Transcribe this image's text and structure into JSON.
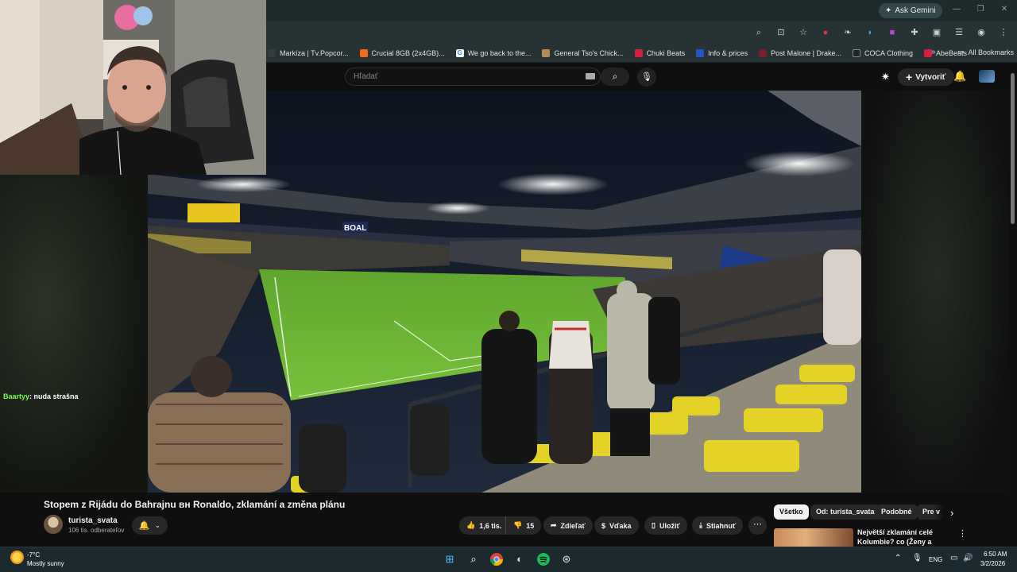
{
  "browser": {
    "ask_gemini": "Ask Gemini",
    "bookmarks": [
      {
        "label": "Markíza | Tv.Popcor...",
        "color": "#3a3a3a"
      },
      {
        "label": "Crucial 8GB (2x4GB)...",
        "color": "#f26b1d"
      },
      {
        "label": "We go back to the...",
        "color": "#4285f4"
      },
      {
        "label": "General Tso's Chick...",
        "color": "#b58a55"
      },
      {
        "label": "Chuki Beats",
        "color": "#d21f3c"
      },
      {
        "label": "Info & prices",
        "color": "#2454c6"
      },
      {
        "label": "Post Malone | Drake...",
        "color": "#7b1d2e"
      },
      {
        "label": "COCA Clothing",
        "color": "#222222"
      },
      {
        "label": "AbeBeats",
        "color": "#d21f3c"
      }
    ],
    "all_bookmarks": "All Bookmarks"
  },
  "youtube": {
    "search_placeholder": "Hľadať",
    "create_label": "Vytvoriť"
  },
  "chat": {
    "user": "Baartyy",
    "message": ": nuda strašna"
  },
  "video": {
    "title": "Stopem z Rijádu do Bahrajnu вн Ronaldo, zklamání a změna plánu",
    "channel": "turista_svata",
    "subscribers": "106 tis. odberateľov",
    "likes": "1,6 tis.",
    "dislikes": "15",
    "share": "Zdieľať",
    "thanks": "Vďaka",
    "save": "Uložiť",
    "download": "Stiahnuť"
  },
  "chips": [
    "Všetko",
    "Od: turista_svata",
    "Podobné",
    "Pre v"
  ],
  "recommendation": {
    "title": "Největší zklamání celé Kolumbie? co (Ženy a Krádeže)"
  },
  "taskbar": {
    "temperature": "-7°C",
    "weather": "Mostly sunny",
    "language": "ENG",
    "time": "6:50 AM",
    "date": "3/2/2026"
  },
  "stadium_sign": "BOAL"
}
